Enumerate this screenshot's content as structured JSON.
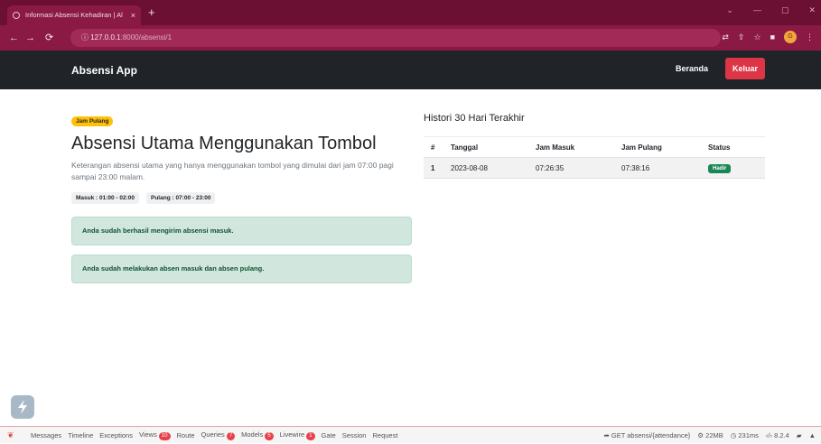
{
  "browser": {
    "tab_title": "Informasi Absensi Kehadiran | Al",
    "tab_close": "×",
    "new_tab": "+",
    "url_host": "127.0.0.1",
    "url_path": ":8000/absensi/1",
    "win_controls": [
      "⌄",
      "—",
      "▢",
      "✕"
    ]
  },
  "navbar": {
    "brand": "Absensi App",
    "home": "Beranda",
    "logout": "Keluar"
  },
  "left": {
    "badge": "Jam Pulang",
    "title": "Absensi Utama Menggunakan Tombol",
    "description": "Keterangan absensi utama yang hanya menggunakan tombol yang dimulai dari jam 07:00 pagi sampai 23:00 malam.",
    "time_in": "Masuk : 01:00 - 02:00",
    "time_out": "Pulang : 07:00 - 23:00",
    "alert_1": "Anda sudah berhasil mengirim absensi masuk.",
    "alert_2": "Anda sudah melakukan absen masuk dan absen pulang."
  },
  "history": {
    "title": "Histori 30 Hari Terakhir",
    "columns": [
      "#",
      "Tanggal",
      "Jam Masuk",
      "Jam Pulang",
      "Status"
    ],
    "rows": [
      {
        "no": "1",
        "date": "2023-08-08",
        "in": "07:26:35",
        "out": "07:38:16",
        "status": "Hadir"
      }
    ]
  },
  "debugbar": {
    "tabs": [
      {
        "label": "Messages"
      },
      {
        "label": "Timeline"
      },
      {
        "label": "Exceptions"
      },
      {
        "label": "Views",
        "count": "10"
      },
      {
        "label": "Route"
      },
      {
        "label": "Queries",
        "count": "7"
      },
      {
        "label": "Models",
        "count": "5"
      },
      {
        "label": "Livewire",
        "count": "1"
      },
      {
        "label": "Gate"
      },
      {
        "label": "Session"
      },
      {
        "label": "Request"
      }
    ],
    "route": "GET absensi/{attendance}",
    "memory": "22MB",
    "time": "231ms",
    "version": "8.2.4"
  },
  "colors": {
    "browser_frame": "#6b0f33",
    "navbar": "#202428",
    "logout": "#dc3545",
    "warning": "#ffc107",
    "success": "#198754",
    "alert_bg": "#d1e7dd"
  }
}
